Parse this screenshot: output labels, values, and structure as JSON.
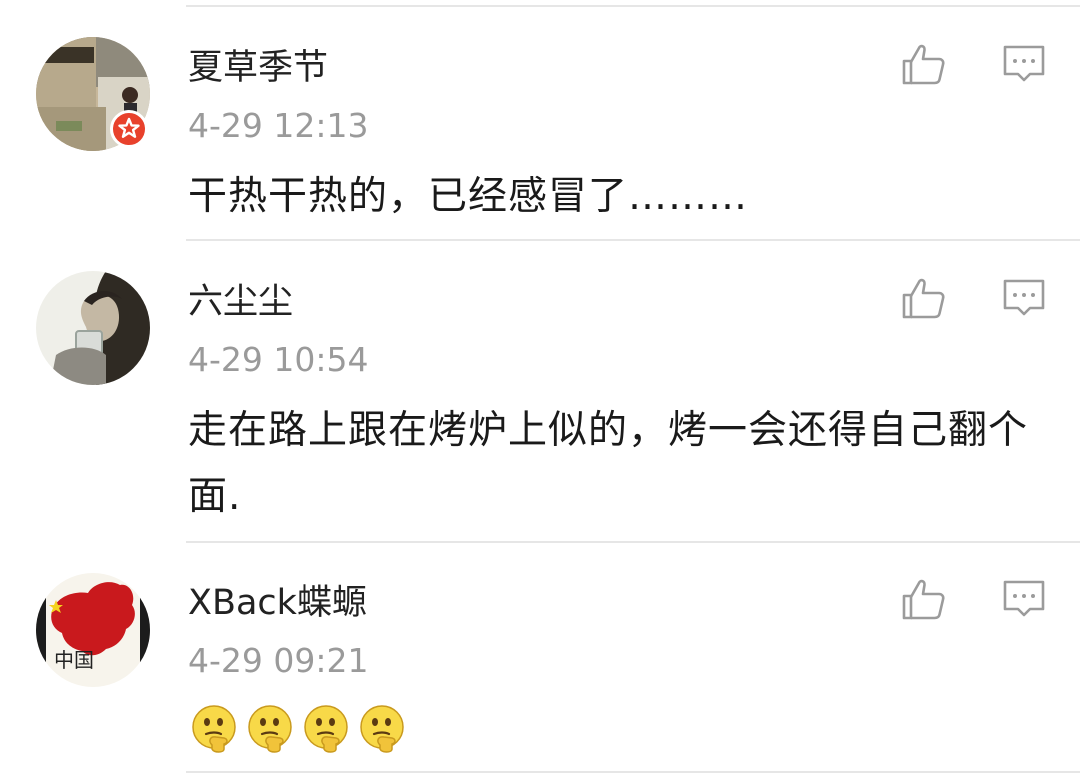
{
  "comments": [
    {
      "username": "夏草季节",
      "time": "4-29 12:13",
      "text": "干热干热的，已经感冒了………",
      "verified": true,
      "avatar_icon": "street-scene-avatar",
      "like_icon": "thumbs-up-icon",
      "reply_icon": "comment-bubble-icon"
    },
    {
      "username": "六尘尘",
      "time": "4-29 10:54",
      "text": "走在路上跟在烤炉上似的，烤一会还得自己翻个面.",
      "verified": false,
      "avatar_icon": "person-drinking-avatar",
      "like_icon": "thumbs-up-icon",
      "reply_icon": "comment-bubble-icon"
    },
    {
      "username": "XBack蝶螈",
      "time": "4-29 09:21",
      "text": "",
      "emoji_count": 4,
      "emoji_name": "thinking-face-emoji",
      "verified": false,
      "avatar_icon": "china-map-avatar",
      "avatar_text": "中国",
      "like_icon": "thumbs-up-icon",
      "reply_icon": "comment-bubble-icon"
    }
  ],
  "colors": {
    "username": "#222222",
    "timestamp": "#9a9a9a",
    "icon": "#9b9b9b",
    "divider": "#e6e6e6",
    "vip_badge": "#e8412c"
  }
}
